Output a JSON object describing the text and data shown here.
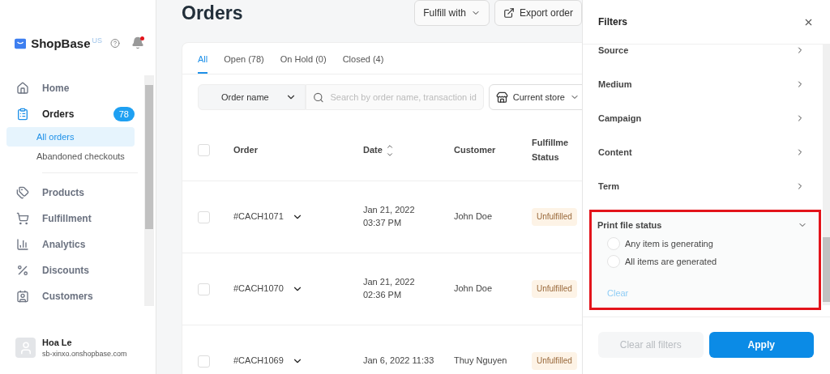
{
  "sidebar": {
    "logo": "ShopBase",
    "region": "US",
    "notification": true,
    "items": [
      {
        "label": "Home",
        "selected": false
      },
      {
        "label": "Orders",
        "selected": true,
        "badge": "78",
        "children": [
          {
            "label": "All orders",
            "selected": true
          },
          {
            "label": "Abandoned checkouts",
            "selected": false
          }
        ]
      },
      {
        "label": "Products",
        "selected": false
      },
      {
        "label": "Fulfillment",
        "selected": false
      },
      {
        "label": "Analytics",
        "selected": false
      },
      {
        "label": "Discounts",
        "selected": false
      },
      {
        "label": "Customers",
        "selected": false
      }
    ],
    "user": {
      "name": "Hoa Le",
      "store": "sb-xinxo.onshopbase.com"
    }
  },
  "page": {
    "title": "Orders",
    "actions": [
      {
        "label": "Fulfill with",
        "kind": "dropdown"
      },
      {
        "label": "Export order",
        "kind": "export"
      }
    ]
  },
  "tabs": [
    {
      "label": "All",
      "selected": true
    },
    {
      "label": "Open (78)",
      "selected": false
    },
    {
      "label": "On Hold (0)",
      "selected": false
    },
    {
      "label": "Closed (4)",
      "selected": false
    }
  ],
  "filter_bar": {
    "field": "Order name",
    "search_placeholder": "Search by order name, transaction id",
    "store": "Current store"
  },
  "table": {
    "select_all_checked": false,
    "columns": [
      "Order",
      "Date",
      "Customer",
      "Fulfillme Status"
    ],
    "rows": [
      {
        "order": "#CACH1071",
        "date": "Jan 21, 2022",
        "time": "03:37 PM",
        "customer": "John Doe",
        "status": "Unfulfilled",
        "checked": false
      },
      {
        "order": "#CACH1070",
        "date": "Jan 21, 2022",
        "time": "02:36 PM",
        "customer": "John Doe",
        "status": "Unfulfilled",
        "checked": false
      },
      {
        "order": "#CACH1069",
        "date": "Jan 6, 2022 11:33",
        "customer": "Thuy Nguyen",
        "status": "Unfulfilled",
        "checked": false
      }
    ]
  },
  "filters": {
    "title": "Filters",
    "items": [
      {
        "label": "Source",
        "expanded": false
      },
      {
        "label": "Medium",
        "expanded": false
      },
      {
        "label": "Campaign",
        "expanded": false
      },
      {
        "label": "Content",
        "expanded": false
      },
      {
        "label": "Term",
        "expanded": false
      },
      {
        "label": "Print file status",
        "expanded": true,
        "highlighted": true,
        "options": [
          {
            "label": "Any item is generating",
            "selected": false
          },
          {
            "label": "All items are generated",
            "selected": false
          }
        ],
        "clear": "Clear"
      }
    ],
    "buttons": [
      {
        "label": "Clear all filters",
        "disabled": true
      },
      {
        "label": "Apply",
        "disabled": false
      }
    ]
  }
}
